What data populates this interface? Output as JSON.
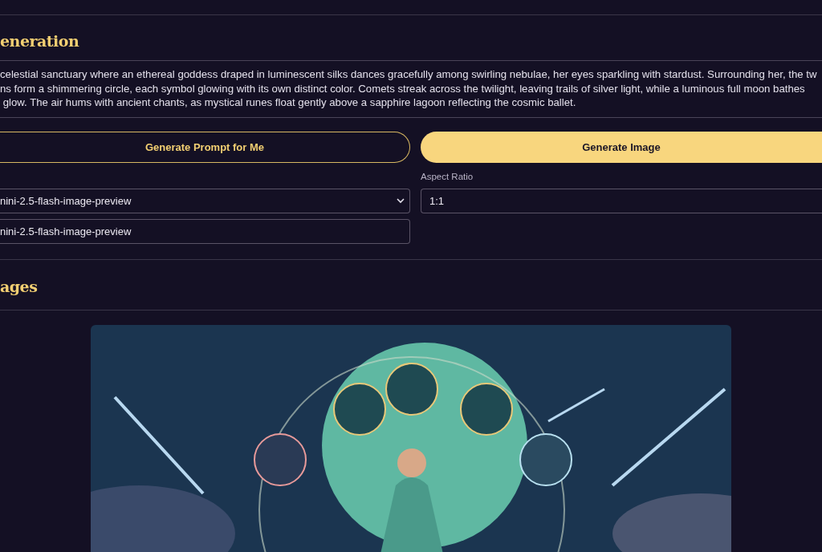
{
  "generation": {
    "heading": "eneration",
    "prompt_lines": [
      "celestial sanctuary where an ethereal goddess draped in luminescent silks dances gracefully among swirling nebulae, her eyes sparkling with stardust. Surrounding her, the tw",
      "ns form a shimmering circle, each symbol glowing with its own distinct color. Comets streak across the twilight, leaving trails of silver light, while a luminous full moon bathes",
      " glow. The air hums with ancient chants, as mystical runes float gently above a sapphire lagoon reflecting the cosmic ballet."
    ],
    "buttons": [
      {
        "label": "Generate Prompt for Me",
        "kind": "outline"
      },
      {
        "label": "Generate Image",
        "kind": "filled"
      }
    ],
    "model_select": {
      "value": "nini-2.5-flash-image-preview"
    },
    "model_field": {
      "value": "nini-2.5-flash-image-preview"
    },
    "aspect_ratio": {
      "label": "Aspect Ratio",
      "value": "1:1"
    }
  },
  "images": {
    "heading": "ages"
  }
}
